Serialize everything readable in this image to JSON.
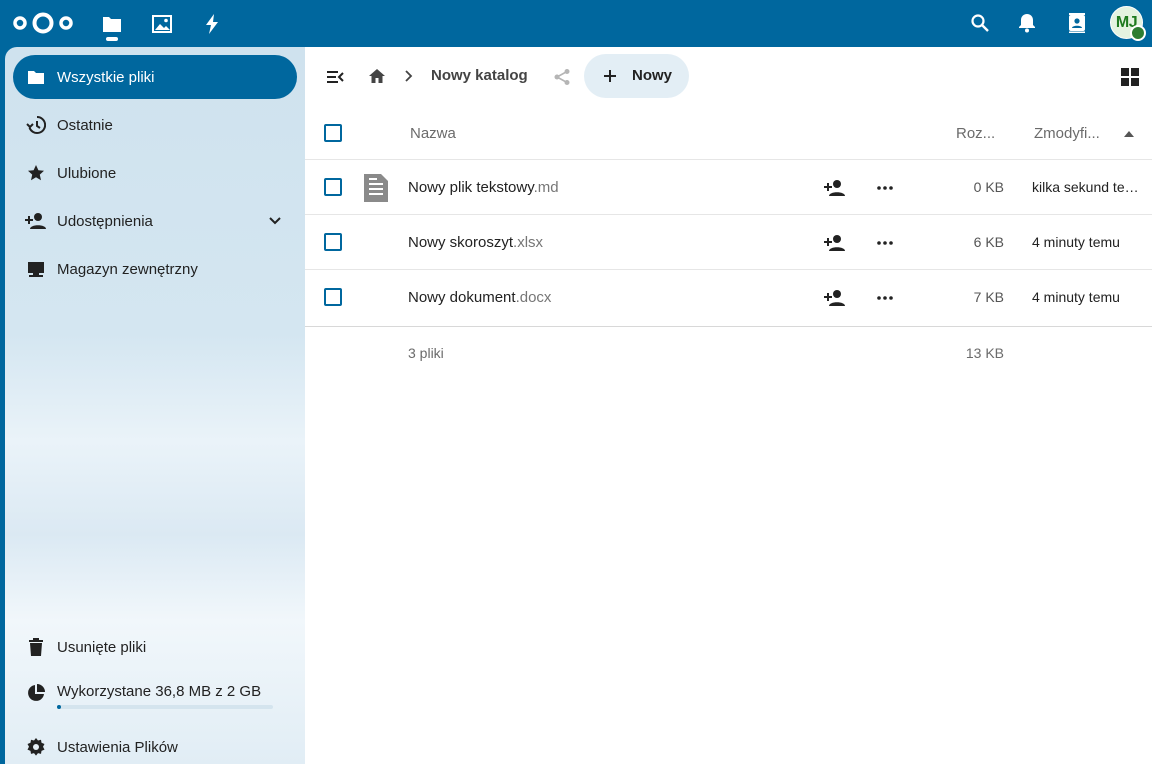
{
  "header": {
    "avatar_initials": "MJ",
    "colors": {
      "bar": "#00679e",
      "status": "#2d7d32"
    },
    "apps": [
      {
        "name": "files",
        "icon": "folder-icon",
        "active": true
      },
      {
        "name": "photos",
        "icon": "image-icon",
        "active": false
      },
      {
        "name": "activity",
        "icon": "lightning-icon",
        "active": false
      }
    ],
    "right_icons": [
      "search-icon",
      "bell-icon",
      "contacts-icon"
    ]
  },
  "sidebar": {
    "items": [
      {
        "label": "Wszystkie pliki",
        "icon": "folder-icon",
        "active": true
      },
      {
        "label": "Ostatnie",
        "icon": "history-icon"
      },
      {
        "label": "Ulubione",
        "icon": "star-icon"
      },
      {
        "label": "Udostępnienia",
        "icon": "share-user-icon",
        "has_chevron": true
      },
      {
        "label": "Magazyn zewnętrzny",
        "icon": "external-storage-icon"
      }
    ],
    "bottom": {
      "trash_label": "Usunięte pliki",
      "quota_label": "Wykorzystane 36,8 MB z 2 GB",
      "quota_fraction": 0.018,
      "settings_label": "Ustawienia Plików"
    }
  },
  "breadcrumb": {
    "current": "Nowy katalog",
    "new_button": "Nowy"
  },
  "table": {
    "headers": {
      "name": "Nazwa",
      "size": "Roz...",
      "modified": "Zmodyfi..."
    },
    "rows": [
      {
        "base": "Nowy plik tekstowy",
        "ext": ".md",
        "size": "0 KB",
        "modified": "kilka sekund temu",
        "icon": "text-file-icon"
      },
      {
        "base": "Nowy skoroszyt",
        "ext": ".xlsx",
        "size": "6 KB",
        "modified": "4 minuty temu",
        "icon": ""
      },
      {
        "base": "Nowy dokument",
        "ext": ".docx",
        "size": "7 KB",
        "modified": "4 minuty temu",
        "icon": ""
      }
    ],
    "summary": {
      "count": "3 pliki",
      "total": "13 KB"
    }
  }
}
